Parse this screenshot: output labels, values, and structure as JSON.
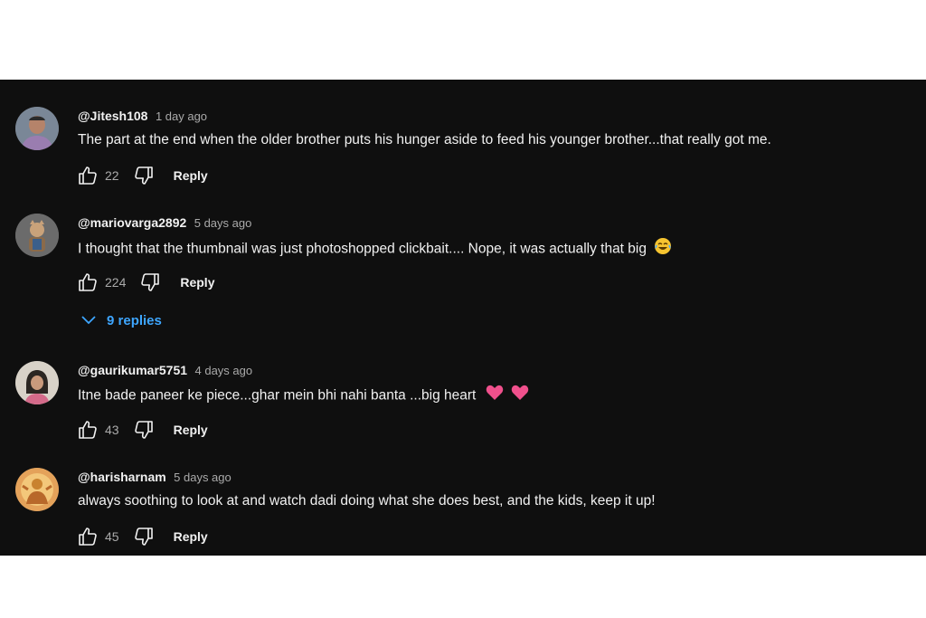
{
  "colors": {
    "background": "#0f0f0f",
    "text": "#f1f1f1",
    "muted": "#aaaaaa",
    "link": "#3ea6ff"
  },
  "icons": {
    "like": "thumbs-up-icon",
    "dislike": "thumbs-down-icon",
    "expand": "chevron-down-icon"
  },
  "comments": [
    {
      "author": "@Jitesh108",
      "time": "1 day ago",
      "text": "The part at the end when the older brother puts his hunger aside to feed his younger brother...that really got me.",
      "likes": "22",
      "reply_label": "Reply"
    },
    {
      "author": "@mariovarga2892",
      "time": "5 days ago",
      "text": "I thought that the thumbnail was just photoshopped clickbait.... Nope, it was actually that big",
      "emoji": "laughing-emoji",
      "likes": "224",
      "reply_label": "Reply",
      "replies_label": "9 replies"
    },
    {
      "author": "@gaurikumar5751",
      "time": "4 days ago",
      "text": "Itne bade paneer ke piece...ghar mein bhi nahi banta ...big heart",
      "emoji": "pink-heart-emoji",
      "likes": "43",
      "reply_label": "Reply"
    },
    {
      "author": "@harisharnam",
      "time": "5 days ago",
      "text": "always soothing to look at and watch dadi doing what she does best, and the kids, keep it up!",
      "likes": "45",
      "reply_label": "Reply"
    }
  ]
}
